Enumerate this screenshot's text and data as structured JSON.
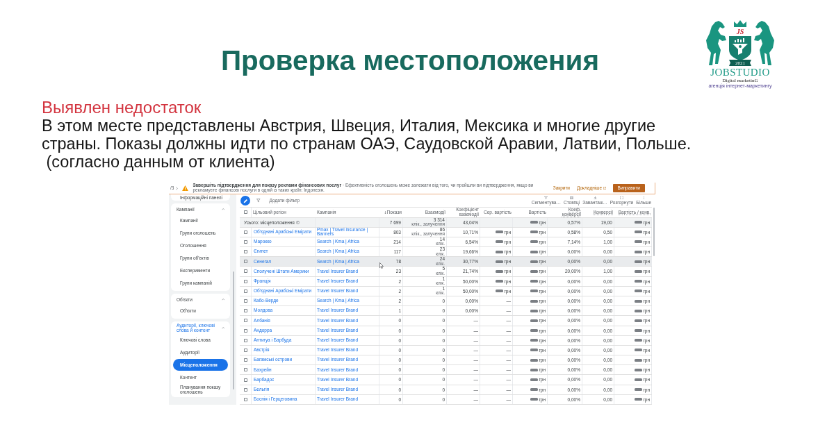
{
  "slide": {
    "title": "Проверка местоположения",
    "logo": {
      "monogram": "JS",
      "year": "2021",
      "name": "JOBSTUDIO",
      "tagline": "Digital marketinG",
      "subtitle": "агенція інтернет-маркетингу"
    },
    "issue_heading": "Выявлен недостаток",
    "issue_text": "В этом месте представлены Австрия, Швеция, Италия, Мексика и многие другие\nстраны. Показы должны идти по странам ОАЭ, Саудовской Аравии, Латвии, Польше.\n (согласно данным от клиента)"
  },
  "screenshot": {
    "notification": {
      "pager": "/3",
      "message": "**Завершіть підтвердження для показу реклами фінансових послуг** · Ефективність оголошень може залежати від того, чи пройшли ви підтвердження, якщо ви рекламуєте фінансові послуги в одній із таких країн: Індонезія.",
      "actions": [
        {
          "label": "Закрити",
          "kind": "link"
        },
        {
          "label": "Докладніше",
          "kind": "external"
        },
        {
          "label": "Виправити",
          "kind": "button"
        }
      ]
    },
    "sidebar": {
      "top_item": "Інформаційні панелі",
      "sections": [
        {
          "title": "Кампанії",
          "expanded": true,
          "active": false,
          "items": [
            {
              "label": "Кампанії",
              "selected": false
            },
            {
              "label": "Групи оголошень",
              "selected": false
            },
            {
              "label": "Оголошення",
              "selected": false
            },
            {
              "label": "Групи об'єктів",
              "selected": false
            },
            {
              "label": "Експерименти",
              "selected": false
            },
            {
              "label": "Групи кампаній",
              "selected": false
            }
          ]
        },
        {
          "title": "Об'єкти",
          "expanded": true,
          "active": false,
          "items": [
            {
              "label": "Об'єкти",
              "selected": false
            }
          ]
        },
        {
          "title": "Аудиторії, ключові слова й контент",
          "expanded": true,
          "active": true,
          "items": [
            {
              "label": "Ключові слова",
              "selected": false
            },
            {
              "label": "Аудиторії",
              "selected": false
            },
            {
              "label": "Місцеположення",
              "selected": true
            },
            {
              "label": "Контент",
              "selected": false
            },
            {
              "label": "Планування показу оголошень",
              "selected": false
            }
          ]
        }
      ]
    },
    "toolbar": {
      "add_filter": "Додати фільтр",
      "tools": [
        {
          "label": "Сегментува…",
          "kind": "segment"
        },
        {
          "label": "Стовпці",
          "kind": "columns"
        },
        {
          "label": "Завантаж…",
          "kind": "download"
        },
        {
          "label": "Розгорнути",
          "kind": "expand"
        },
        {
          "label": "Більше",
          "kind": "more"
        }
      ]
    },
    "table": {
      "select_all_checked": false,
      "columns": [
        {
          "label": "Цільовий регіон",
          "sorted": false,
          "underlined": false
        },
        {
          "label": "Кампанія",
          "sorted": false,
          "underlined": false
        },
        {
          "label": "Покази",
          "sorted": true,
          "underlined": false
        },
        {
          "label": "Взаємодії",
          "sorted": false,
          "underlined": false
        },
        {
          "label": "Коефіцієнт взаємодії",
          "sorted": false,
          "underlined": false
        },
        {
          "label": "Сер. вартість",
          "sorted": false,
          "underlined": false
        },
        {
          "label": "Вартість",
          "sorted": false,
          "underlined": false
        },
        {
          "label": "Коеф. конверсії",
          "sorted": false,
          "underlined": true
        },
        {
          "label": "Конверсії",
          "sorted": false,
          "underlined": true
        },
        {
          "label": "Вартість / конв.",
          "sorted": false,
          "underlined": true
        }
      ],
      "total": {
        "label": "Усього: місцеположення",
        "impressions": "7 699",
        "interactions": "3 314",
        "interactions_unit": "клік., залучення",
        "interaction_rate": "43,04%",
        "cost": {
          "blurred": true,
          "unit": "грн"
        },
        "conv_rate": "0,57%",
        "conversions": "19,00",
        "cost_per_conv": {
          "blurred": true,
          "unit": "грн"
        }
      },
      "rows": [
        {
          "checked": false,
          "hovered": false,
          "region": "Об'єднані Арабські Емірати",
          "campaign": "Pmax | Travel insurance | Banners",
          "impressions": "803",
          "interactions": "86",
          "interactions_unit": "клік., залучення",
          "interaction_rate": "10,71%",
          "avg_cost": {
            "blurred": true,
            "unit": "грн"
          },
          "cost": {
            "blurred": true,
            "unit": "грн"
          },
          "conv_rate": "0,58%",
          "conversions": "0,50",
          "cost_per_conv": {
            "blurred": true,
            "unit": "грн"
          }
        },
        {
          "checked": false,
          "hovered": false,
          "region": "Марокко",
          "campaign": "Search | Kma | Africa",
          "impressions": "214",
          "interactions": "14",
          "interactions_unit": "клік.",
          "interaction_rate": "6,54%",
          "avg_cost": {
            "blurred": true,
            "unit": "грн"
          },
          "cost": {
            "blurred": true,
            "unit": "грн"
          },
          "conv_rate": "7,14%",
          "conversions": "1,00",
          "cost_per_conv": {
            "blurred": true,
            "unit": "грн"
          }
        },
        {
          "checked": false,
          "hovered": false,
          "region": "Єгипет",
          "campaign": "Search | Kma | Africa",
          "impressions": "117",
          "interactions": "23",
          "interactions_unit": "клік.",
          "interaction_rate": "19,66%",
          "avg_cost": {
            "blurred": true,
            "unit": "грн"
          },
          "cost": {
            "blurred": true,
            "unit": "грн"
          },
          "conv_rate": "0,00%",
          "conversions": "0,00",
          "cost_per_conv": {
            "blurred": true,
            "unit": "грн"
          }
        },
        {
          "checked": false,
          "hovered": true,
          "region": "Сенегал",
          "campaign": "Search | Kma | Africa",
          "impressions": "78",
          "interactions": "24",
          "interactions_unit": "клік.",
          "interaction_rate": "30,77%",
          "avg_cost": {
            "blurred": true,
            "unit": "грн"
          },
          "cost": {
            "blurred": true,
            "unit": "грн"
          },
          "conv_rate": "0,00%",
          "conversions": "0,00",
          "cost_per_conv": {
            "blurred": true,
            "unit": "грн"
          }
        },
        {
          "checked": false,
          "hovered": false,
          "region": "Сполучені Штати Америки",
          "campaign": "Travel Insurer Brand",
          "impressions": "23",
          "interactions": "5",
          "interactions_unit": "клік.",
          "interaction_rate": "21,74%",
          "avg_cost": {
            "blurred": true,
            "unit": "грн"
          },
          "cost": {
            "blurred": true,
            "unit": "грн"
          },
          "conv_rate": "20,00%",
          "conversions": "1,00",
          "cost_per_conv": {
            "blurred": true,
            "unit": "грн"
          }
        },
        {
          "checked": false,
          "hovered": false,
          "region": "Франція",
          "campaign": "Travel Insurer Brand",
          "impressions": "2",
          "interactions": "1",
          "interactions_unit": "клік.",
          "interaction_rate": "50,00%",
          "avg_cost": {
            "blurred": true,
            "unit": "грн"
          },
          "cost": {
            "blurred": true,
            "unit": "грн"
          },
          "conv_rate": "0,00%",
          "conversions": "0,00",
          "cost_per_conv": {
            "blurred": true,
            "unit": "грн"
          }
        },
        {
          "checked": false,
          "hovered": false,
          "region": "Об'єднані Арабські Емірати",
          "campaign": "Travel Insurer Brand",
          "impressions": "2",
          "interactions": "1",
          "interactions_unit": "клік.",
          "interaction_rate": "50,00%",
          "avg_cost": {
            "blurred": true,
            "unit": "грн"
          },
          "cost": {
            "blurred": true,
            "unit": "грн"
          },
          "conv_rate": "0,00%",
          "conversions": "0,00",
          "cost_per_conv": {
            "blurred": true,
            "unit": "грн"
          }
        },
        {
          "checked": false,
          "hovered": false,
          "region": "Кабо-Верде",
          "campaign": "Search | Kma | Africa",
          "impressions": "2",
          "interactions": "0",
          "interaction_rate": "0,00%",
          "avg_cost": "—",
          "cost": {
            "blurred": true,
            "unit": "грн"
          },
          "conv_rate": "0,00%",
          "conversions": "0,00",
          "cost_per_conv": {
            "blurred": true,
            "unit": "грн"
          }
        },
        {
          "checked": false,
          "hovered": false,
          "region": "Молдова",
          "campaign": "Travel Insurer Brand",
          "impressions": "1",
          "interactions": "0",
          "interaction_rate": "0,00%",
          "avg_cost": "—",
          "cost": {
            "blurred": true,
            "unit": "грн"
          },
          "conv_rate": "0,00%",
          "conversions": "0,00",
          "cost_per_conv": {
            "blurred": true,
            "unit": "грн"
          }
        },
        {
          "checked": false,
          "hovered": false,
          "region": "Албанія",
          "campaign": "Travel Insurer Brand",
          "impressions": "0",
          "interactions": "0",
          "interaction_rate": "—",
          "avg_cost": "—",
          "cost": {
            "blurred": true,
            "unit": "грн"
          },
          "conv_rate": "0,00%",
          "conversions": "0,00",
          "cost_per_conv": {
            "blurred": true,
            "unit": "грн"
          }
        },
        {
          "checked": false,
          "hovered": false,
          "region": "Андорра",
          "campaign": "Travel Insurer Brand",
          "impressions": "0",
          "interactions": "0",
          "interaction_rate": "—",
          "avg_cost": "—",
          "cost": {
            "blurred": true,
            "unit": "грн"
          },
          "conv_rate": "0,00%",
          "conversions": "0,00",
          "cost_per_conv": {
            "blurred": true,
            "unit": "грн"
          }
        },
        {
          "checked": false,
          "hovered": false,
          "region": "Антигуа і Барбуда",
          "campaign": "Travel Insurer Brand",
          "impressions": "0",
          "interactions": "0",
          "interaction_rate": "—",
          "avg_cost": "—",
          "cost": {
            "blurred": true,
            "unit": "грн"
          },
          "conv_rate": "0,00%",
          "conversions": "0,00",
          "cost_per_conv": {
            "blurred": true,
            "unit": "грн"
          }
        },
        {
          "checked": false,
          "hovered": false,
          "region": "Австрія",
          "campaign": "Travel Insurer Brand",
          "impressions": "0",
          "interactions": "0",
          "interaction_rate": "—",
          "avg_cost": "—",
          "cost": {
            "blurred": true,
            "unit": "грн"
          },
          "conv_rate": "0,00%",
          "conversions": "0,00",
          "cost_per_conv": {
            "blurred": true,
            "unit": "грн"
          }
        },
        {
          "checked": false,
          "hovered": false,
          "region": "Багамські острови",
          "campaign": "Travel Insurer Brand",
          "impressions": "0",
          "interactions": "0",
          "interaction_rate": "—",
          "avg_cost": "—",
          "cost": {
            "blurred": true,
            "unit": "грн"
          },
          "conv_rate": "0,00%",
          "conversions": "0,00",
          "cost_per_conv": {
            "blurred": true,
            "unit": "грн"
          }
        },
        {
          "checked": false,
          "hovered": false,
          "region": "Бахрейн",
          "campaign": "Travel Insurer Brand",
          "impressions": "0",
          "interactions": "0",
          "interaction_rate": "—",
          "avg_cost": "—",
          "cost": {
            "blurred": true,
            "unit": "грн"
          },
          "conv_rate": "0,00%",
          "conversions": "0,00",
          "cost_per_conv": {
            "blurred": true,
            "unit": "грн"
          }
        },
        {
          "checked": false,
          "hovered": false,
          "region": "Барбадос",
          "campaign": "Travel Insurer Brand",
          "impressions": "0",
          "interactions": "0",
          "interaction_rate": "—",
          "avg_cost": "—",
          "cost": {
            "blurred": true,
            "unit": "грн"
          },
          "conv_rate": "0,00%",
          "conversions": "0,00",
          "cost_per_conv": {
            "blurred": true,
            "unit": "грн"
          }
        },
        {
          "checked": false,
          "hovered": false,
          "region": "Бельгія",
          "campaign": "Travel Insurer Brand",
          "impressions": "0",
          "interactions": "0",
          "interaction_rate": "—",
          "avg_cost": "—",
          "cost": {
            "blurred": true,
            "unit": "грн"
          },
          "conv_rate": "0,00%",
          "conversions": "0,00",
          "cost_per_conv": {
            "blurred": true,
            "unit": "грн"
          }
        },
        {
          "checked": false,
          "hovered": false,
          "region": "Боснія і Герцеговина",
          "campaign": "Travel Insurer Brand",
          "impressions": "0",
          "interactions": "0",
          "interaction_rate": "—",
          "avg_cost": "—",
          "cost": {
            "blurred": true,
            "unit": "грн"
          },
          "conv_rate": "0,00%",
          "conversions": "0,00",
          "cost_per_conv": {
            "blurred": true,
            "unit": "грн"
          }
        }
      ]
    }
  }
}
